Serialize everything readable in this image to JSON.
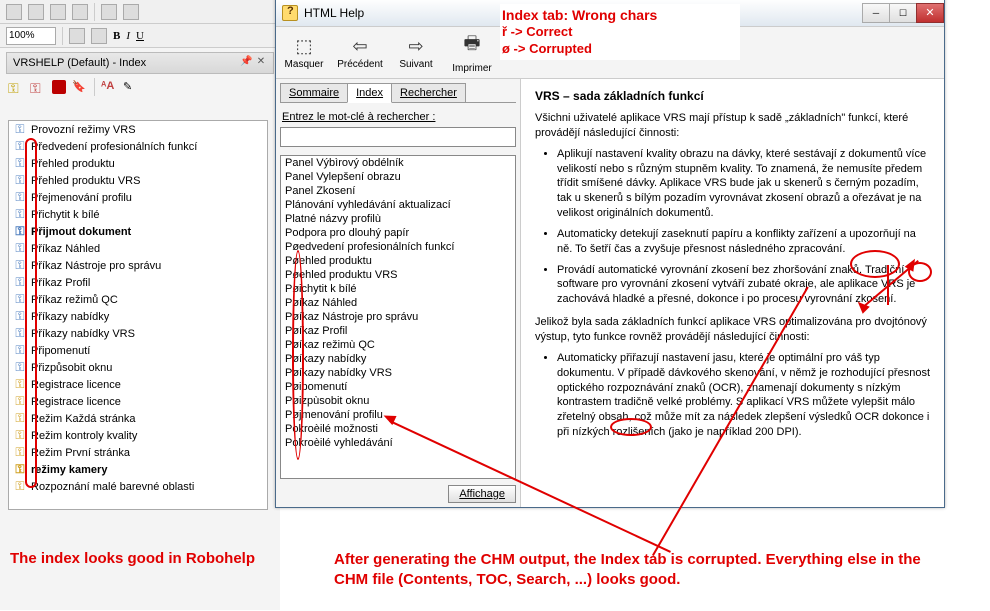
{
  "rh": {
    "title": "VRSHELP (Default) - Index",
    "zoom": "100%",
    "items": [
      {
        "k": "b",
        "label": "Provozní režimy VRS"
      },
      {
        "k": "b",
        "label": "Předvedení profesionálních funkcí"
      },
      {
        "k": "b",
        "label": "Přehled produktu"
      },
      {
        "k": "b",
        "label": "Přehled produktu VRS"
      },
      {
        "k": "b",
        "label": "Přejmenování profilu"
      },
      {
        "k": "b",
        "label": "Přichytit k bílé"
      },
      {
        "k": "b",
        "label": "Přijmout dokument",
        "bold": true
      },
      {
        "k": "b",
        "label": "Příkaz Náhled"
      },
      {
        "k": "b",
        "label": "Příkaz Nástroje pro správu"
      },
      {
        "k": "b",
        "label": "Příkaz Profil"
      },
      {
        "k": "b",
        "label": "Příkaz režimů QC"
      },
      {
        "k": "b",
        "label": "Příkazy nabídky"
      },
      {
        "k": "b",
        "label": "Příkazy nabídky VRS"
      },
      {
        "k": "b",
        "label": "Připomenutí"
      },
      {
        "k": "b",
        "label": "Přizpůsobit oknu"
      },
      {
        "k": "y",
        "label": "Registrace licence"
      },
      {
        "k": "y",
        "label": "Registrace licence"
      },
      {
        "k": "y",
        "label": "Režim Každá stránka"
      },
      {
        "k": "y",
        "label": "Režim kontroly kvality"
      },
      {
        "k": "y",
        "label": "Režim První stránka"
      },
      {
        "k": "y",
        "label": "režimy kamery",
        "bold": true
      },
      {
        "k": "y",
        "label": "Rozpoznání malé barevné oblasti"
      }
    ]
  },
  "chm": {
    "title": "HTML Help",
    "toolbar": {
      "hide": "Masquer",
      "prev": "Précédent",
      "next": "Suivant",
      "print": "Imprimer"
    },
    "tabs": {
      "summary": "Sommaire",
      "index": "Index",
      "search": "Rechercher"
    },
    "searchLabel": "Entrez le mot-clé à rechercher :",
    "affBtn": "Affichage",
    "indexItems": [
      "Panel Výbìrový obdélník",
      "Panel Vylepšení obrazu",
      "Panel Zkosení",
      "Plánování vyhledávání aktualizací",
      "Platné názvy profilù",
      "Podpora pro dlouhý papír",
      "Pøedvedení profesionálních funkcí",
      "Pøehled produktu",
      "Pøehled produktu VRS",
      "Pøichytit k bílé",
      "Pøíkaz Náhled",
      "Pøíkaz Nástroje pro správu",
      "Pøíkaz Profil",
      "Pøíkaz režimù QC",
      "Pøíkazy nabídky",
      "Pøíkazy nabídky VRS",
      "Pøipomenutí",
      "Pøizpùsobit oknu",
      "Pøjmenování profilu",
      "Pokroèilé možnosti",
      "Pokroèilé vyhledávání"
    ],
    "content": {
      "heading": "VRS – sada základních funkcí",
      "intro": "Všichni uživatelé aplikace VRS mají přístup k sadě „základních\" funkcí, které provádějí následující činnosti:",
      "b1": "Aplikují nastavení kvality obrazu na dávky, které sestávají z dokumentů více velikostí nebo s různým stupněm kvality. To znamená, že nemusíte předem třídit smíšené dávky. Aplikace VRS bude jak u skenerů s černým pozadím, tak u skenerů s bílým pozadím vyrovnávat zkosení obrazů a ořezávat je na velikost originálních dokumentů.",
      "b2": "Automaticky detekují zaseknutí papíru a konflikty zařízení a upozorňují na ně. To šetří čas a zvyšuje přesnost následného zpracování.",
      "b3": "Provádí automatické vyrovnání zkosení bez zhoršování znaků. Tradiční software pro vyrovnání zkosení vytváří zubaté okraje, ale aplikace VRS je zachovává hladké a přesné, dokonce i po procesu vyrovnání zkosení.",
      "mid": "Jelikož byla sada základních funkcí aplikace VRS optimalizována pro dvojtónový výstup, tyto funkce rovněž provádějí následující činnosti:",
      "b4": "Automaticky přiřazují nastavení jasu, které je optimální pro váš typ dokumentu. V případě dávkového skenování, v němž je rozhodující přesnost optického rozpoznávání znaků (OCR), znamenají dokumenty s nízkým kontrastem tradičně velké problémy. S aplikací VRS můžete vylepšit málo zřetelný obsah, což může mít za následek zlepšení výsledků OCR dokonce i při nízkých rozlišeních (jako je například 200 DPI)."
    }
  },
  "ann": {
    "top1": "Index tab: Wrong chars",
    "top2": "ř -> Correct",
    "top3": "ø -> Corrupted",
    "left": "The index looks good in Robohelp",
    "bottom": "After generating the CHM output, the Index tab is corrupted. Everything else in the CHM file (Contents, TOC, Search, ...) looks good."
  }
}
